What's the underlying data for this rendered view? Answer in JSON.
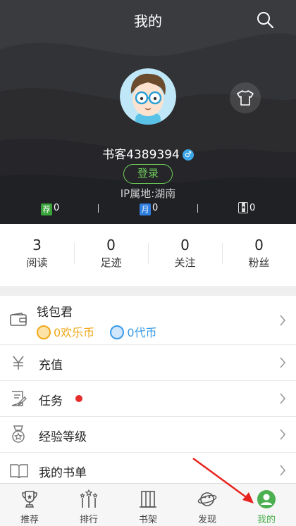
{
  "header": {
    "title": "我的",
    "username": "书客4389394",
    "gender_symbol": "♂",
    "login_label": "登录",
    "ip_location": "IP属地:湖南",
    "tickets": [
      {
        "badge": "荐",
        "color": "#3aa43a",
        "count": "0"
      },
      {
        "badge": "月",
        "color": "#2f7fe0",
        "count": "0"
      },
      {
        "badge": "",
        "color": "#777777",
        "count": "0"
      }
    ]
  },
  "stats": [
    {
      "value": "3",
      "label": "阅读"
    },
    {
      "value": "0",
      "label": "足迹"
    },
    {
      "value": "0",
      "label": "关注"
    },
    {
      "value": "0",
      "label": "粉丝"
    }
  ],
  "menu": {
    "wallet": {
      "title": "钱包君",
      "happy_coin": "0欢乐币",
      "voucher_coin": "0代币"
    },
    "items": [
      {
        "label": "充值",
        "icon": "yen-icon"
      },
      {
        "label": "任务",
        "icon": "task-icon"
      },
      {
        "label": "经验等级",
        "icon": "medal-icon"
      },
      {
        "label": "我的书单",
        "icon": "book-list-icon"
      }
    ]
  },
  "bottom_nav": [
    {
      "label": "推荐",
      "icon": "trophy-icon",
      "active": false
    },
    {
      "label": "排行",
      "icon": "rank-icon",
      "active": false
    },
    {
      "label": "书架",
      "icon": "bookshelf-icon",
      "active": false
    },
    {
      "label": "发现",
      "icon": "planet-icon",
      "active": false
    },
    {
      "label": "我的",
      "icon": "user-icon",
      "active": true
    }
  ],
  "colors": {
    "header_bg": "#3a3b3f",
    "accent_green": "#4caf50",
    "coin_gold": "#f0a81c",
    "coin_blue": "#3a9be8",
    "badge_red": "#e82c2c",
    "annotation_arrow": "#e8231d"
  }
}
